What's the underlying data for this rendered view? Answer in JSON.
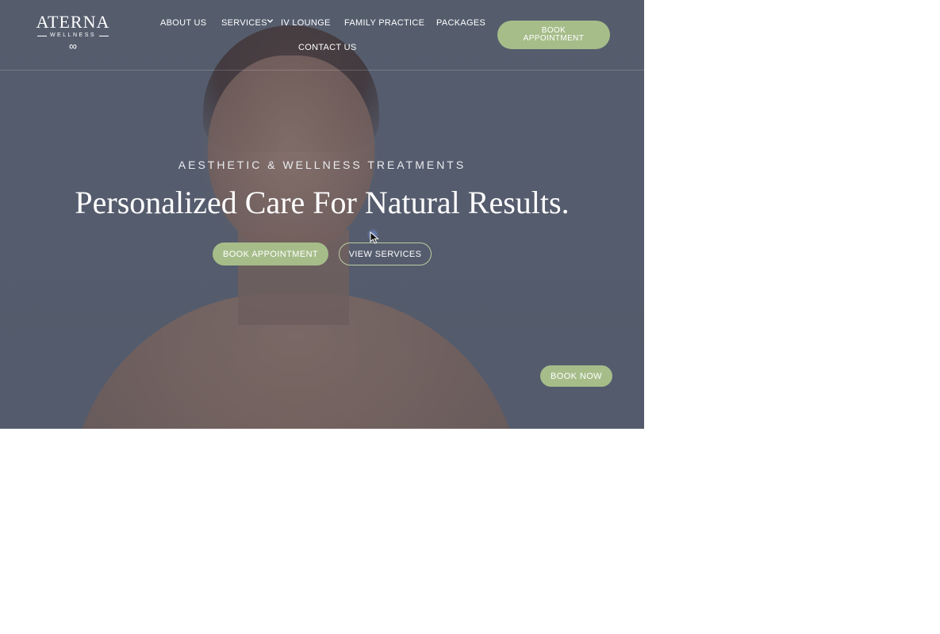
{
  "brand": {
    "name": "ATERNA",
    "tagline": "WELLNESS",
    "mark": "∞"
  },
  "nav": {
    "items": [
      {
        "label": "ABOUT US"
      },
      {
        "label": "SERVICES",
        "has_dropdown": true
      },
      {
        "label": "IV LOUNGE"
      },
      {
        "label": "FAMILY PRACTICE"
      },
      {
        "label": "PACKAGES"
      },
      {
        "label": "CONTACT US"
      }
    ],
    "cta_label": "BOOK APPOINTMENT"
  },
  "hero": {
    "eyebrow": "AESTHETIC & WELLNESS TREATMENTS",
    "headline": "Personalized Care For Natural Results.",
    "primary_button": "BOOK APPOINTMENT",
    "secondary_button": "VIEW SERVICES"
  },
  "floating": {
    "book_now_label": "BOOK NOW"
  },
  "colors": {
    "accent": "#a6bd8a",
    "overlay": "#5b6272",
    "text": "#ffffff"
  },
  "icons": {
    "caret": "chevron-down-icon",
    "cursor": "cursor-arrow-icon"
  }
}
